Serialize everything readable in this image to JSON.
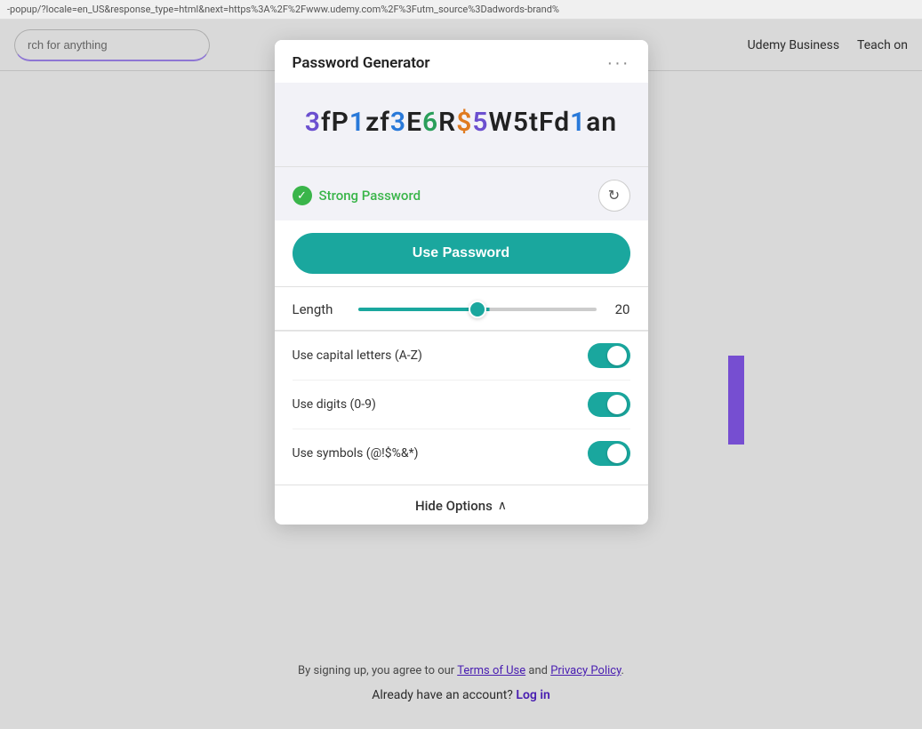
{
  "url_bar": {
    "text": "-popup/?locale=en_US&response_type=html&next=https%3A%2F%2Fwww.udemy.com%2F%3Futm_source%3Dadwords-brand%"
  },
  "navbar": {
    "search_placeholder": "rch for anything",
    "links": [
      {
        "id": "udemy-business",
        "label": "Udemy Business"
      },
      {
        "id": "teach-on",
        "label": "Teach on"
      }
    ]
  },
  "popup": {
    "title": "Password Generator",
    "menu_icon": "···",
    "password": {
      "chars": [
        {
          "char": "3",
          "type": "purple"
        },
        {
          "char": "f",
          "type": "black"
        },
        {
          "char": "P",
          "type": "black"
        },
        {
          "char": "1",
          "type": "blue"
        },
        {
          "char": "z",
          "type": "black"
        },
        {
          "char": "f",
          "type": "black"
        },
        {
          "char": "3",
          "type": "blue"
        },
        {
          "char": "E",
          "type": "black"
        },
        {
          "char": "6",
          "type": "green"
        },
        {
          "char": "R",
          "type": "black"
        },
        {
          "char": "$",
          "type": "orange"
        },
        {
          "char": "5",
          "type": "purple"
        },
        {
          "char": "W",
          "type": "black"
        },
        {
          "char": "5",
          "type": "black"
        },
        {
          "char": "t",
          "type": "black"
        },
        {
          "char": "F",
          "type": "black"
        },
        {
          "char": "d",
          "type": "black"
        },
        {
          "char": "1",
          "type": "blue"
        },
        {
          "char": "a",
          "type": "black"
        },
        {
          "char": "n",
          "type": "black"
        }
      ]
    },
    "strength_label": "Strong Password",
    "refresh_icon": "↻",
    "use_password_label": "Use Password",
    "length": {
      "label": "Length",
      "value": 20,
      "min": 8,
      "max": 32
    },
    "toggles": [
      {
        "id": "capital-letters",
        "label": "Use capital letters (A-Z)",
        "enabled": true
      },
      {
        "id": "digits",
        "label": "Use digits (0-9)",
        "enabled": true
      },
      {
        "id": "symbols",
        "label": "Use symbols (@!$%&*)",
        "enabled": true
      }
    ],
    "hide_options_label": "Hide Options",
    "chevron_up": "∧"
  },
  "footer": {
    "terms_text_prefix": "By signing up, you agree to our ",
    "terms_of_use": "Terms of Use",
    "terms_text_mid": " and ",
    "privacy_policy": "Privacy Policy",
    "terms_text_suffix": ".",
    "account_text": "Already have an account?",
    "login_label": "Log in"
  }
}
